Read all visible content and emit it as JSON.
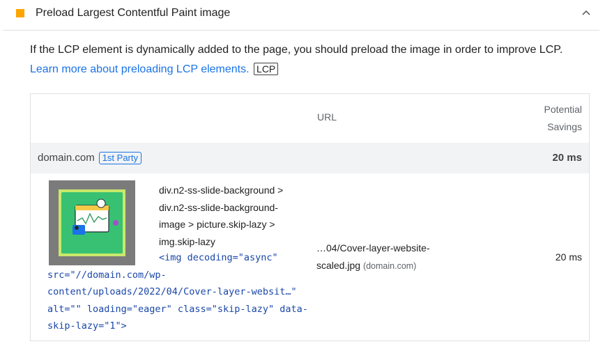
{
  "audit": {
    "title": "Preload Largest Contentful Paint image",
    "status_color": "#ffa400",
    "description_text": "If the LCP element is dynamically added to the page, you should preload the image in order to improve LCP.",
    "learn_more_link": "Learn more about preloading LCP elements.",
    "badge": "LCP"
  },
  "table": {
    "header_url": "URL",
    "header_savings_line1": "Potential",
    "header_savings_line2": "Savings",
    "group": {
      "domain": "domain.com",
      "party_badge": "1st Party",
      "savings": "20 ms"
    },
    "row": {
      "selector": "div.n2-ss-slide-background > div.n2-ss-slide-background-image > picture.skip-lazy > img.skip-lazy",
      "snippet_line1": "<img decoding=\"async\"",
      "snippet_rest": "src=\"//domain.com/wp-content/uploads/2022/04/Cover-layer-websit…\" alt=\"\" loading=\"eager\" class=\"skip-lazy\" data-skip-lazy=\"1\">",
      "url_text": "…04/Cover-layer-website-scaled.jpg",
      "url_domain": "(domain.com)",
      "savings": "20 ms"
    }
  }
}
